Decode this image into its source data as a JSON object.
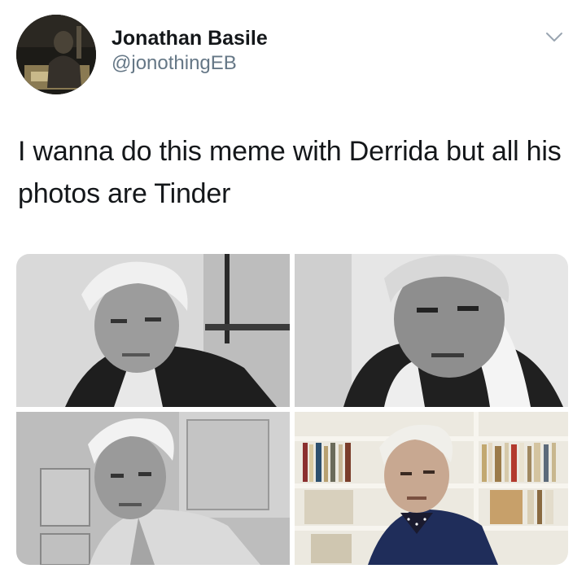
{
  "tweet": {
    "author": {
      "display_name": "Jonathan Basile",
      "handle": "@jonothingEB",
      "avatar_icon": "profile-photo"
    },
    "menu_icon": "chevron-down-icon",
    "text": "I wanna do this meme with Derrida but all his photos are Tinder",
    "media": [
      {
        "icon": "portrait-photo",
        "tone": "grayscale"
      },
      {
        "icon": "portrait-photo",
        "tone": "grayscale"
      },
      {
        "icon": "portrait-photo",
        "tone": "grayscale"
      },
      {
        "icon": "portrait-photo",
        "tone": "color"
      }
    ]
  },
  "colors": {
    "text_primary": "#14171a",
    "text_secondary": "#657786",
    "background": "#ffffff"
  }
}
